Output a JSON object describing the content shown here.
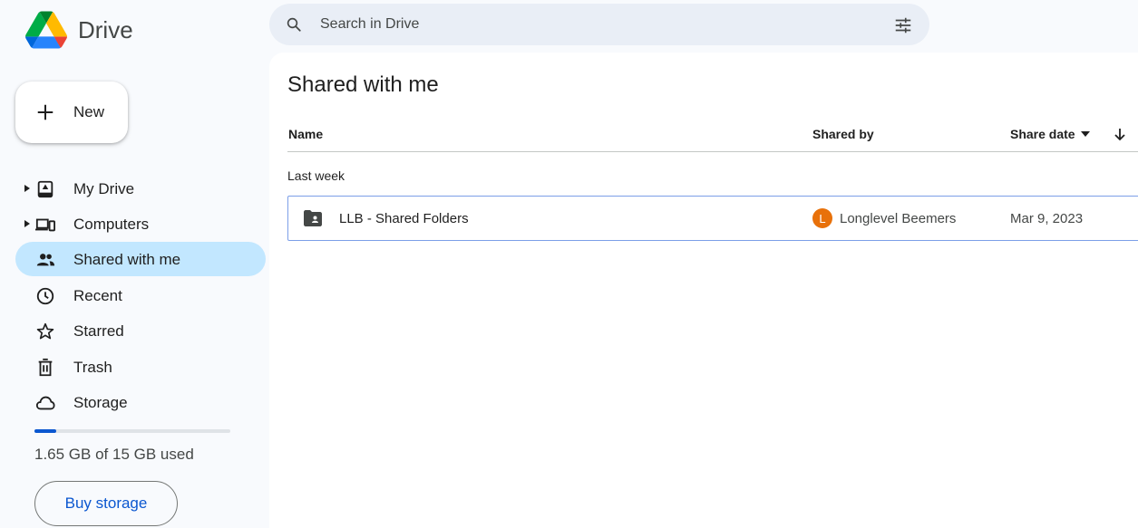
{
  "app": {
    "name": "Drive"
  },
  "search": {
    "placeholder": "Search in Drive"
  },
  "new_button": {
    "label": "New"
  },
  "sidebar": {
    "items": [
      {
        "label": "My Drive",
        "icon": "my-drive-icon",
        "expandable": true,
        "active": false
      },
      {
        "label": "Computers",
        "icon": "computers-icon",
        "expandable": true,
        "active": false
      },
      {
        "label": "Shared with me",
        "icon": "shared-with-me-icon",
        "expandable": false,
        "active": true
      },
      {
        "label": "Recent",
        "icon": "clock-icon",
        "expandable": false,
        "active": false
      },
      {
        "label": "Starred",
        "icon": "star-icon",
        "expandable": false,
        "active": false
      },
      {
        "label": "Trash",
        "icon": "trash-icon",
        "expandable": false,
        "active": false
      },
      {
        "label": "Storage",
        "icon": "cloud-icon",
        "expandable": false,
        "active": false
      }
    ],
    "storage": {
      "used_text": "1.65 GB of 15 GB used",
      "used_fraction": 0.11
    },
    "buy_storage_label": "Buy storage"
  },
  "main": {
    "title": "Shared with me",
    "columns": {
      "name": "Name",
      "shared_by": "Shared by",
      "share_date": "Share date"
    },
    "group_label": "Last week",
    "rows": [
      {
        "name": "LLB - Shared Folders",
        "type": "shared-folder",
        "owner_initial": "L",
        "owner": "Longlevel Beemers",
        "date": "Mar 9, 2023"
      }
    ]
  },
  "colors": {
    "accent": "#0b57d0",
    "active_nav": "#c2e7ff",
    "search_bg": "#e9eef6",
    "avatar": "#e8710a"
  }
}
